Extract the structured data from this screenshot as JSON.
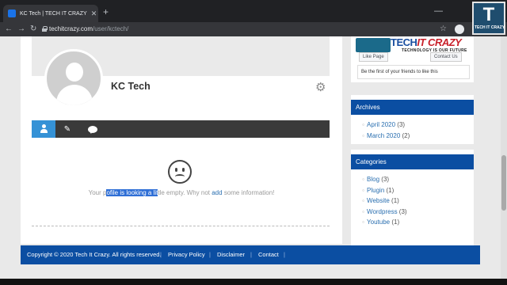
{
  "browser": {
    "tab_title": "KC Tech | TECH IT CRAZY",
    "new_tab_symbol": "+",
    "tab_close_symbol": "✕",
    "minimize_symbol": "—",
    "url_host": "techitcrazy.com",
    "url_path": "/user/kctech/",
    "back_icon": "←",
    "forward_icon": "→",
    "reload_icon": "↻",
    "star_icon": "☆"
  },
  "profile": {
    "name": "KC Tech",
    "settings_icon": "⚙",
    "edit_icon": "✎",
    "empty_message": {
      "part1": "Your p",
      "selected": "ofile is looking a lit",
      "part2": "tle empty. Why not ",
      "link": "add",
      "part3": " some information!"
    }
  },
  "sidebar": {
    "facebook": {
      "brand_left": "TECH",
      "brand_right": "IT CRAZY",
      "tagline": "TECHNOLOGY IS OUR FUTURE",
      "like_label": "Like Page",
      "contact_label": "Contact Us",
      "friends_text": "Be the first of your friends to like this"
    },
    "archives": {
      "title": "Archives",
      "items": [
        {
          "label": "April 2020",
          "count": "(3)"
        },
        {
          "label": "March 2020",
          "count": "(2)"
        }
      ]
    },
    "categories": {
      "title": "Categories",
      "items": [
        {
          "label": "Blog",
          "count": "(3)"
        },
        {
          "label": "Plugin",
          "count": "(1)"
        },
        {
          "label": "Website",
          "count": "(1)"
        },
        {
          "label": "Wordpress",
          "count": "(3)"
        },
        {
          "label": "Youtube",
          "count": "(1)"
        }
      ]
    }
  },
  "footer": {
    "copyright": "Copyright © 2020 Tech It Crazy. All rights reserved.",
    "links": [
      "Privacy Policy",
      "Disclaimer",
      "Contact"
    ],
    "separator": "|"
  },
  "watermark": {
    "letter": "T",
    "text": "TECH IT CRAZY"
  }
}
